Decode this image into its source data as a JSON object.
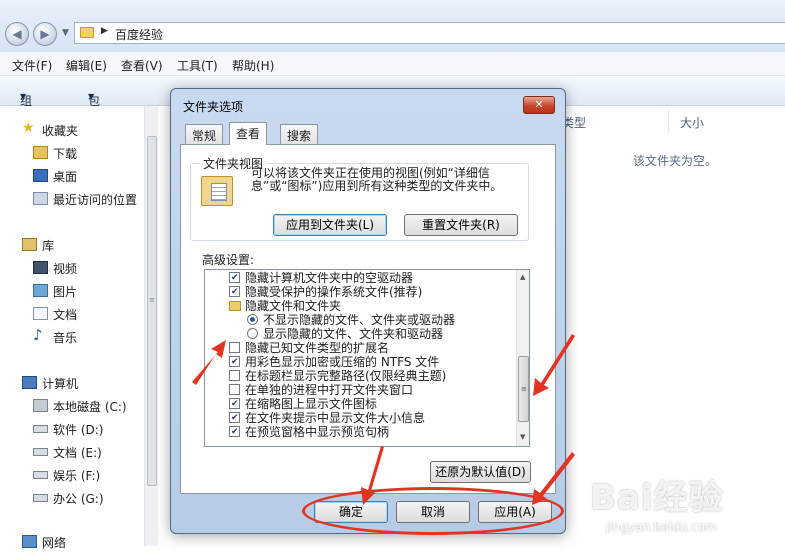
{
  "explorer": {
    "address_path": "百度经验",
    "menu": [
      "文件(F)",
      "编辑(E)",
      "查看(V)",
      "工具(T)",
      "帮助(H)"
    ],
    "toolbar": {
      "organize": "组织",
      "include_in_library": "包含到库中"
    },
    "nav": {
      "favorites": "收藏夹",
      "downloads": "下载",
      "desktop": "桌面",
      "recent_places": "最近访问的位置",
      "libraries": "库",
      "videos": "视频",
      "pictures": "图片",
      "documents": "文档",
      "music": "音乐",
      "computer": "计算机",
      "local_disk": "本地磁盘 (C:)",
      "software": "软件 (D:)",
      "docs_drive": "文档 (E:)",
      "entertainment": "娱乐 (F:)",
      "office": "办公 (G:)",
      "network": "网络"
    },
    "columns": {
      "type": "类型",
      "size": "大小"
    },
    "empty_message": "该文件夹为空。"
  },
  "dialog": {
    "title": "文件夹选项",
    "close_glyph": "✕",
    "tabs": [
      "常规",
      "查看",
      "搜索"
    ],
    "active_tab": "查看",
    "folder_views": {
      "label": "文件夹视图",
      "description": "可以将该文件夹正在使用的视图(例如“详细信息”或“图标”)应用到所有这种类型的文件夹中。",
      "apply_button": "应用到文件夹(L)",
      "reset_button": "重置文件夹(R)"
    },
    "advanced_label": "高级设置:",
    "advanced_settings": [
      {
        "kind": "check",
        "checked": true,
        "label": "隐藏计算机文件夹中的空驱动器"
      },
      {
        "kind": "check",
        "checked": true,
        "label": "隐藏受保护的操作系统文件(推荐)"
      },
      {
        "kind": "folder",
        "label": "隐藏文件和文件夹"
      },
      {
        "kind": "radio",
        "checked": true,
        "label": "不显示隐藏的文件、文件夹或驱动器"
      },
      {
        "kind": "radio",
        "checked": false,
        "label": "显示隐藏的文件、文件夹和驱动器"
      },
      {
        "kind": "check",
        "checked": false,
        "label": "隐藏已知文件类型的扩展名"
      },
      {
        "kind": "check",
        "checked": true,
        "label": "用彩色显示加密或压缩的 NTFS 文件"
      },
      {
        "kind": "check",
        "checked": false,
        "label": "在标题栏显示完整路径(仅限经典主题)"
      },
      {
        "kind": "check",
        "checked": false,
        "label": "在单独的进程中打开文件夹窗口"
      },
      {
        "kind": "check",
        "checked": true,
        "label": "在缩略图上显示文件图标"
      },
      {
        "kind": "check",
        "checked": true,
        "label": "在文件夹提示中显示文件大小信息"
      },
      {
        "kind": "check",
        "checked": true,
        "label": "在预览窗格中显示预览句柄"
      }
    ],
    "restore_defaults": "还原为默认值(D)",
    "ok": "确定",
    "cancel": "取消",
    "apply": "应用(A)"
  },
  "watermark": {
    "brand": "Bai经验",
    "url": "jingyan.baidu.com"
  },
  "colors": {
    "annotation_red": "#e53323",
    "title_blue": "#b6cbe6"
  }
}
